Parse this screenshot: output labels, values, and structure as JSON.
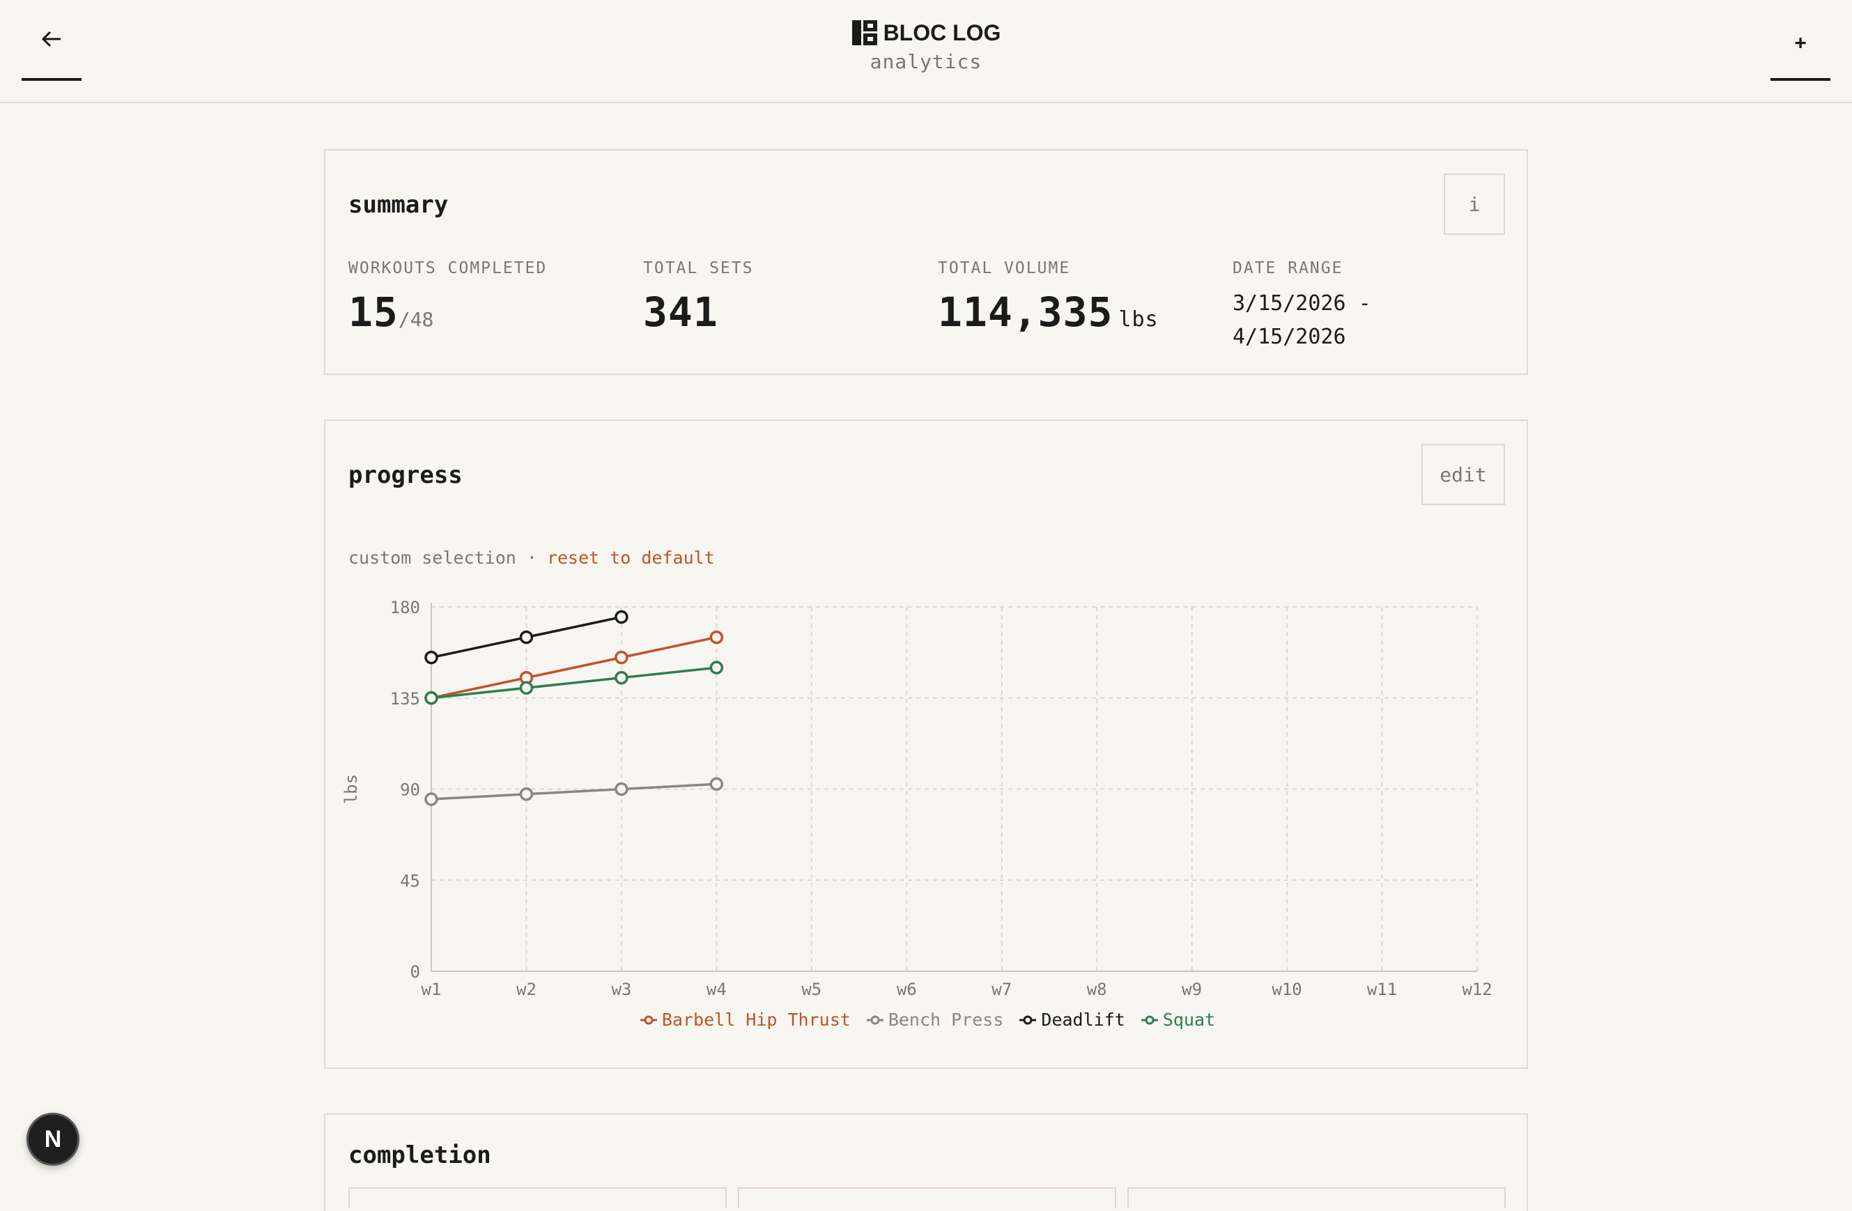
{
  "header": {
    "brand": "BLOC LOG",
    "subtitle": "analytics",
    "back_icon": "arrow-left-icon",
    "add_label": "+"
  },
  "summary": {
    "title": "summary",
    "info_label": "i",
    "workouts_label": "WORKOUTS COMPLETED",
    "workouts_value": "15",
    "workouts_total": "/48",
    "sets_label": "TOTAL SETS",
    "sets_value": "341",
    "volume_label": "TOTAL VOLUME",
    "volume_value": "114,335",
    "volume_unit": "lbs",
    "date_label": "DATE RANGE",
    "date_start": "3/15/2026 -",
    "date_end": "4/15/2026"
  },
  "progress": {
    "title": "progress",
    "edit_label": "edit",
    "selection_text": "custom selection ·",
    "reset_label": "reset to default"
  },
  "completion": {
    "title": "completion"
  },
  "fab": {
    "label": "N"
  },
  "colors": {
    "accent": "#c0532b",
    "bench": "#8a8680",
    "deadlift": "#1b1b1b",
    "squat": "#2e7d4f"
  },
  "chart_data": {
    "type": "line",
    "ylabel": "lbs",
    "xlabel": "",
    "categories": [
      "w1",
      "w2",
      "w3",
      "w4",
      "w5",
      "w6",
      "w7",
      "w8",
      "w9",
      "w10",
      "w11",
      "w12"
    ],
    "yticks": [
      0,
      45,
      90,
      135,
      180
    ],
    "ylim": [
      0,
      180
    ],
    "grid": true,
    "legend_position": "bottom",
    "series": [
      {
        "name": "Barbell Hip Thrust",
        "color": "#c0532b",
        "values": [
          135,
          145,
          155,
          165
        ]
      },
      {
        "name": "Bench Press",
        "color": "#8a8680",
        "values": [
          85,
          87.5,
          90,
          92.5
        ]
      },
      {
        "name": "Deadlift",
        "color": "#1b1b1b",
        "values": [
          155,
          165,
          175
        ]
      },
      {
        "name": "Squat",
        "color": "#2e7d4f",
        "values": [
          135,
          140,
          145,
          150
        ]
      }
    ]
  }
}
